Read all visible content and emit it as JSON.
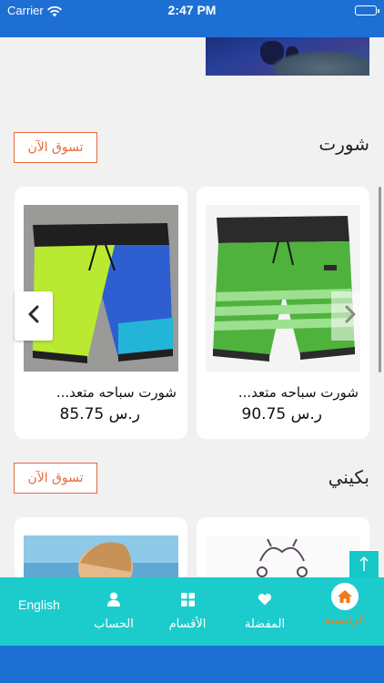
{
  "status_bar": {
    "carrier": "Carrier",
    "time": "2:47 PM"
  },
  "sections": [
    {
      "title": "شورت",
      "shop_now": "تسوق الآن",
      "products": [
        {
          "name": "شورت سباحه متعد...",
          "price": "90.75 ر.س"
        },
        {
          "name": "شورت سباحه متعد...",
          "price": "85.75 ر.س"
        }
      ]
    },
    {
      "title": "بكيني",
      "shop_now": "تسوق الآن"
    }
  ],
  "bottom_nav": {
    "home": "الرئيسية",
    "favorites": "المفضلة",
    "categories": "الأقسام",
    "account": "الحساب",
    "language": "English"
  },
  "colors": {
    "primary_blue": "#1e6fd3",
    "nav_teal": "#1ccccd",
    "accent_orange": "#e76a3d",
    "home_active": "#f07a1a"
  }
}
